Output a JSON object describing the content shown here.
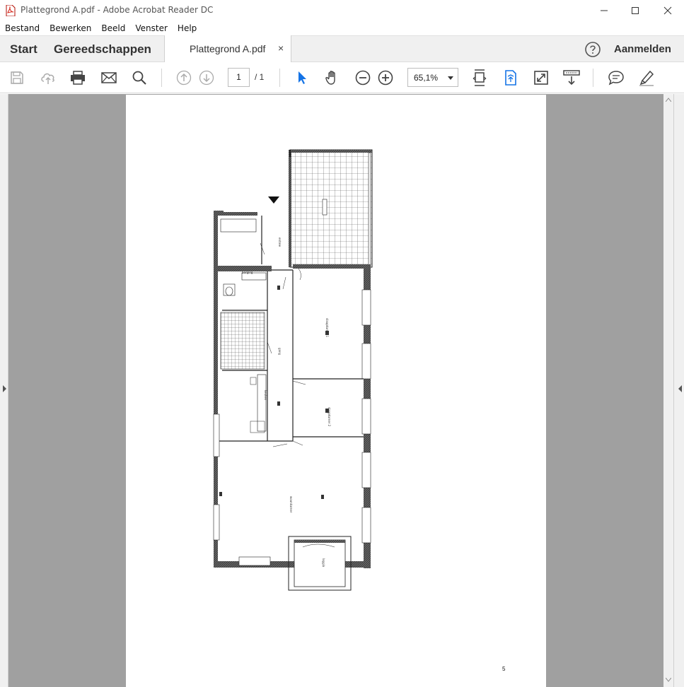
{
  "window": {
    "title": "Plattegrond A.pdf - Adobe Acrobat Reader DC"
  },
  "menu": {
    "items": [
      {
        "label": "Bestand"
      },
      {
        "label": "Bewerken"
      },
      {
        "label": "Beeld"
      },
      {
        "label": "Venster"
      },
      {
        "label": "Help"
      }
    ]
  },
  "tabs": {
    "home": "Start",
    "tools": "Gereedschappen",
    "document": "Plattegrond A.pdf",
    "close_glyph": "×",
    "signin": "Aanmelden"
  },
  "toolbar": {
    "icons": [
      "save-icon",
      "cloud-upload-icon",
      "print-icon",
      "email-icon",
      "search-icon",
      "arrow-up-icon",
      "arrow-down-icon",
      "select-pointer-icon",
      "hand-icon",
      "zoom-out-icon",
      "zoom-in-icon",
      "fit-page-icon",
      "rotate-view-icon",
      "fullscreen-icon",
      "scroll-mode-icon",
      "comment-icon",
      "highlight-pen-icon"
    ],
    "page_current": "1",
    "page_total": "/ 1",
    "zoom": "65,1%"
  },
  "colors": {
    "accent": "#1473e6",
    "workspace": "#a0a0a0",
    "tabbar": "#f0f0f0"
  },
  "document": {
    "page_number": "5"
  }
}
